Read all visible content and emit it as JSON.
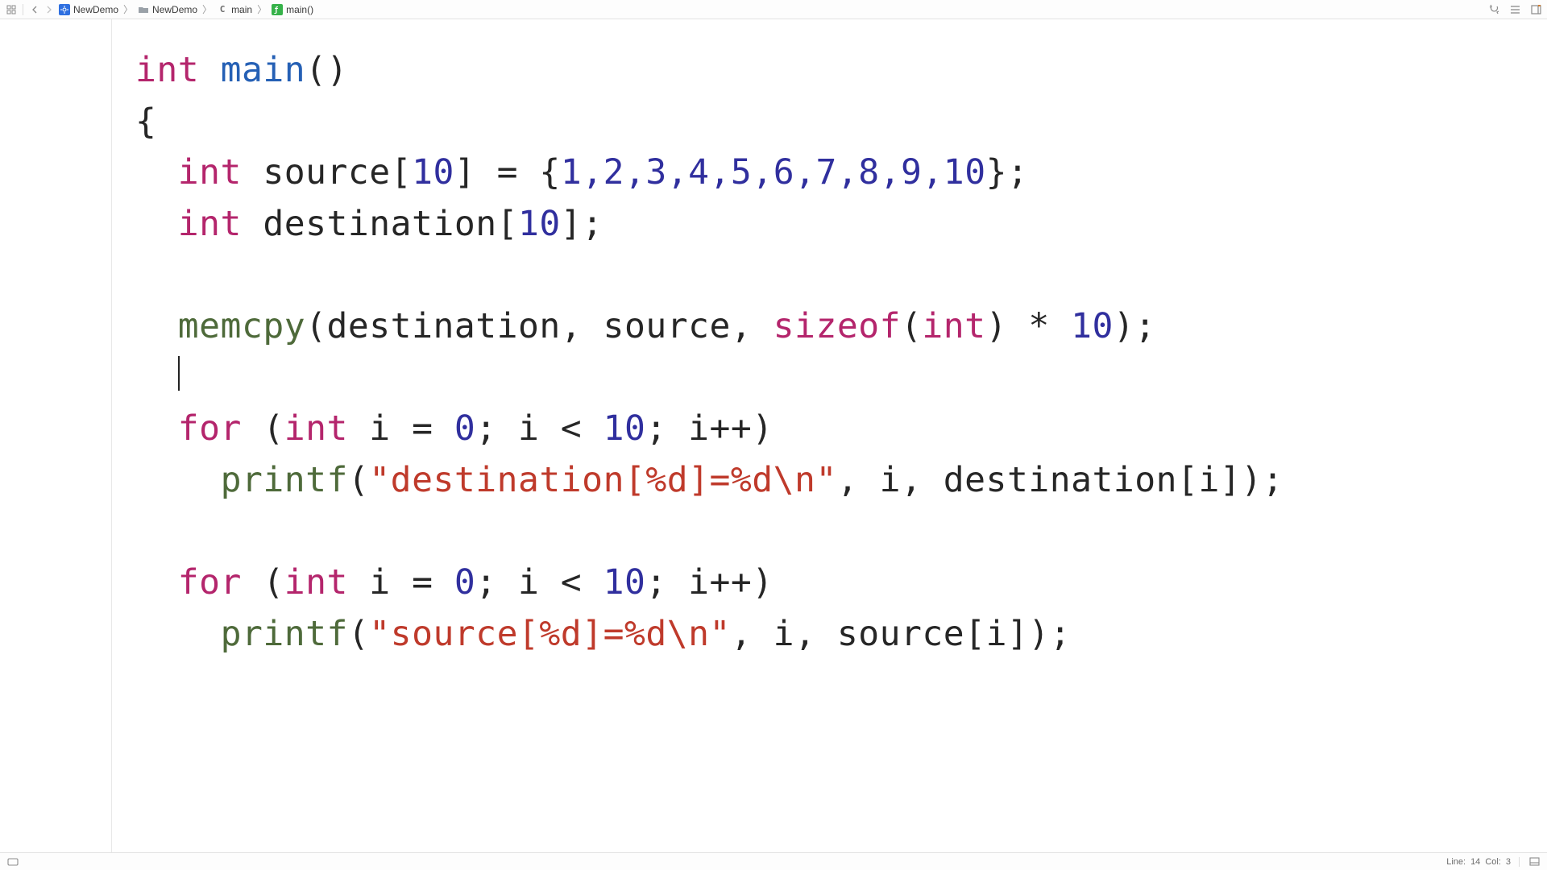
{
  "breadcrumbs": {
    "items": [
      {
        "label": "NewDemo",
        "icon": "target"
      },
      {
        "label": "NewDemo",
        "icon": "folder"
      },
      {
        "label": "main",
        "icon": "c-file"
      },
      {
        "label": "main()",
        "icon": "function"
      }
    ]
  },
  "status": {
    "line_label": "Line:",
    "line": "14",
    "col_label": "Col:",
    "col": "3"
  },
  "code": {
    "l1": {
      "kw": "int",
      "fn": "main",
      "rest": "()"
    },
    "l2": "{",
    "l3": {
      "kw": "int",
      "id": "source",
      "open": "[",
      "n": "10",
      "close": "] = {",
      "vals": "1,2,3,4,5,6,7,8,9,10",
      "end": "};"
    },
    "l4": {
      "kw": "int",
      "id": "destination",
      "open": "[",
      "n": "10",
      "close": "];"
    },
    "l5": "",
    "l6": {
      "call": "memcpy",
      "args_a": "(destination, source, ",
      "sz": "sizeof",
      "args_b": "(",
      "ty": "int",
      "args_c": ") * ",
      "n": "10",
      "end": ");"
    },
    "l7": "",
    "l8": {
      "kw": "for",
      "open": " (",
      "ty": "int",
      "id": " i = ",
      "z": "0",
      "mid": "; i < ",
      "n": "10",
      "end": "; i++)"
    },
    "l9": {
      "call": "printf",
      "open": "(",
      "str": "\"destination[%d]=%d\\n\"",
      "rest": ", i, destination[i]);"
    },
    "l10": "",
    "l11": {
      "kw": "for",
      "open": " (",
      "ty": "int",
      "id": " i = ",
      "z": "0",
      "mid": "; i < ",
      "n": "10",
      "end": "; i++)"
    },
    "l12": {
      "call": "printf",
      "open": "(",
      "str": "\"source[%d]=%d\\n\"",
      "rest": ", i, source[i]);"
    }
  }
}
